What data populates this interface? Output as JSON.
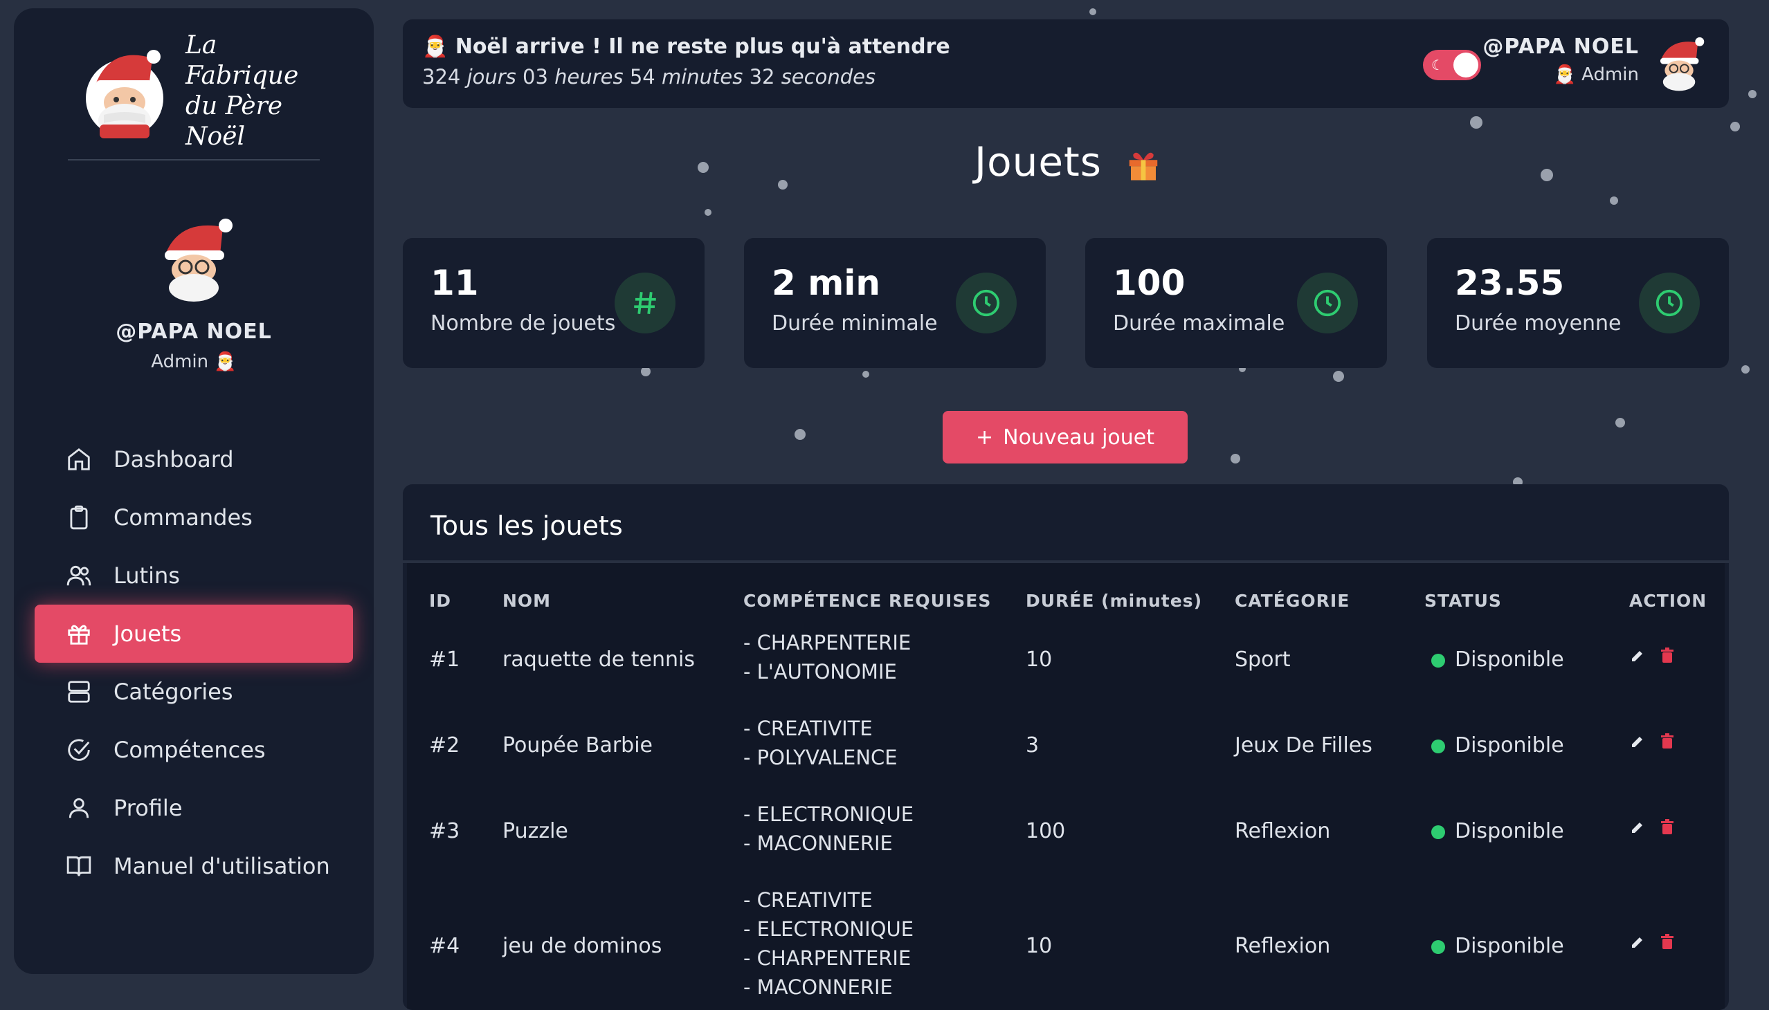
{
  "sidebar": {
    "brand_line1": "La Fabrique",
    "brand_line2": "du Père Noël",
    "user_name": "@PAPA NOEL",
    "user_role": "Admin",
    "nav": [
      {
        "label": "Dashboard",
        "icon": "home-icon"
      },
      {
        "label": "Commandes",
        "icon": "clipboard-icon"
      },
      {
        "label": "Lutins",
        "icon": "users-icon"
      },
      {
        "label": "Jouets",
        "icon": "gift-icon",
        "active": true
      },
      {
        "label": "Catégories",
        "icon": "server-icon"
      },
      {
        "label": "Compétences",
        "icon": "check-circle-icon"
      },
      {
        "label": "Profile",
        "icon": "user-icon"
      },
      {
        "label": "Manuel d'utilisation",
        "icon": "book-icon"
      }
    ]
  },
  "topbar": {
    "countdown_title": "Noël arrive ! Il ne reste plus qu'à attendre",
    "days": "324",
    "days_label": "jours",
    "hours": "03",
    "hours_label": "heures",
    "minutes": "54",
    "minutes_label": "minutes",
    "seconds": "32",
    "seconds_label": "secondes",
    "user_name": "@PAPA NOEL",
    "user_role": "Admin"
  },
  "page": {
    "title": "Jouets",
    "new_button": "Nouveau jouet"
  },
  "stats": [
    {
      "value": "11",
      "label": "Nombre de jouets",
      "icon": "hash-icon"
    },
    {
      "value": "2 min",
      "label": "Durée minimale",
      "icon": "clock-icon"
    },
    {
      "value": "100",
      "label": "Durée maximale",
      "icon": "clock-icon"
    },
    {
      "value": "23.55",
      "label": "Durée moyenne",
      "icon": "clock-icon"
    }
  ],
  "table": {
    "title": "Tous les jouets",
    "headers": [
      "ID",
      "NOM",
      "COMPÉTENCE REQUISES",
      "DURÉE (minutes)",
      "CATÉGORIE",
      "STATUS",
      "ACTION"
    ],
    "rows": [
      {
        "id": "#1",
        "nom": "raquette de tennis",
        "competences": [
          "- CHARPENTERIE",
          "- L'AUTONOMIE"
        ],
        "duree": "10",
        "categorie": "Sport",
        "status": "Disponible"
      },
      {
        "id": "#2",
        "nom": "Poupée Barbie",
        "competences": [
          "- CREATIVITE",
          "- POLYVALENCE"
        ],
        "duree": "3",
        "categorie": "Jeux De Filles",
        "status": "Disponible"
      },
      {
        "id": "#3",
        "nom": "Puzzle",
        "competences": [
          "- ELECTRONIQUE",
          "- MACONNERIE"
        ],
        "duree": "100",
        "categorie": "Reflexion",
        "status": "Disponible"
      },
      {
        "id": "#4",
        "nom": "jeu de dominos",
        "competences": [
          "- CREATIVITE",
          "- ELECTRONIQUE",
          "- CHARPENTERIE",
          "- MACONNERIE"
        ],
        "duree": "10",
        "categorie": "Reflexion",
        "status": "Disponible"
      }
    ]
  },
  "colors": {
    "accent": "#e44a66",
    "success": "#2ecc71",
    "background": "#283041",
    "panel": "#161d2e"
  }
}
